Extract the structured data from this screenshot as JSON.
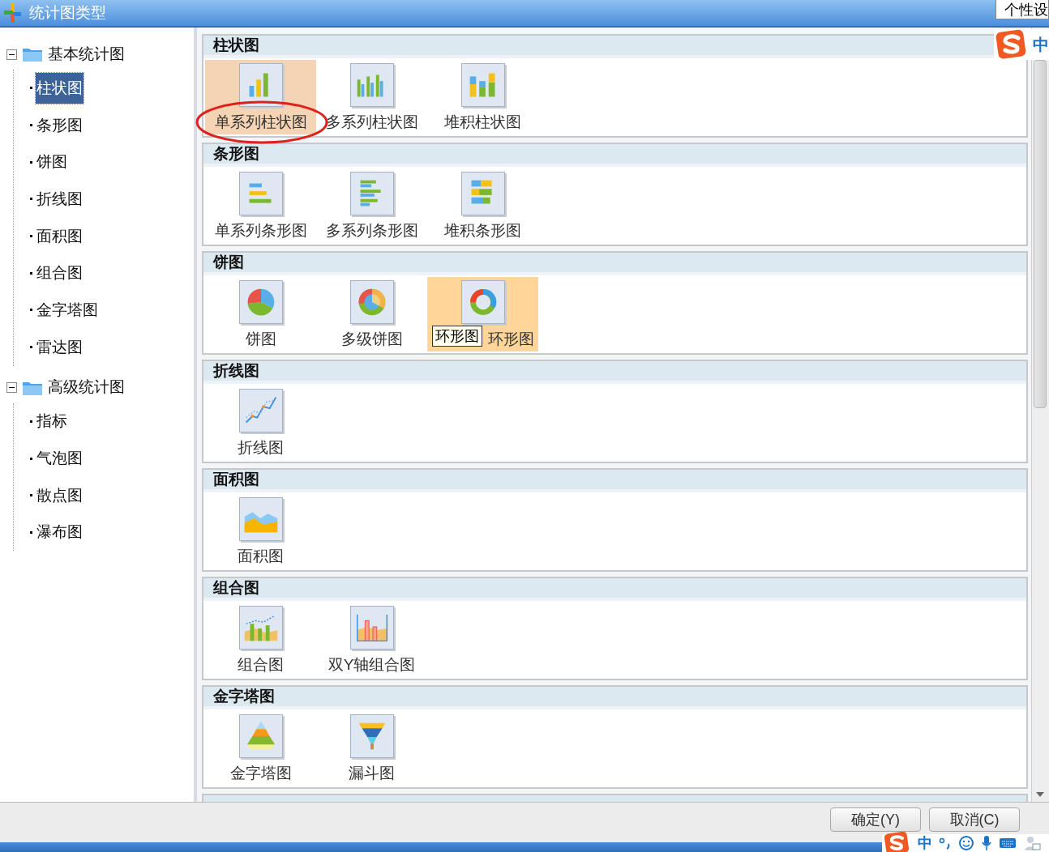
{
  "window": {
    "title": "统计图类型"
  },
  "tree": [
    {
      "label": "基本统计图",
      "expanded": true,
      "children": [
        {
          "label": "柱状图",
          "selected": true
        },
        {
          "label": "条形图",
          "selected": false
        },
        {
          "label": "饼图",
          "selected": false
        },
        {
          "label": "折线图",
          "selected": false
        },
        {
          "label": "面积图",
          "selected": false
        },
        {
          "label": "组合图",
          "selected": false
        },
        {
          "label": "金字塔图",
          "selected": false
        },
        {
          "label": "雷达图",
          "selected": false
        }
      ]
    },
    {
      "label": "高级统计图",
      "expanded": true,
      "children": [
        {
          "label": "指标",
          "selected": false
        },
        {
          "label": "气泡图",
          "selected": false
        },
        {
          "label": "散点图",
          "selected": false
        },
        {
          "label": "瀑布图",
          "selected": false
        }
      ]
    }
  ],
  "sections": [
    {
      "title": "柱状图",
      "items": [
        {
          "label": "单系列柱状图",
          "kind": "bar",
          "selected": true,
          "hovered": false
        },
        {
          "label": "多系列柱状图",
          "kind": "multibar",
          "selected": false,
          "hovered": false
        },
        {
          "label": "堆积柱状图",
          "kind": "stackbar",
          "selected": false,
          "hovered": false
        }
      ]
    },
    {
      "title": "条形图",
      "items": [
        {
          "label": "单系列条形图",
          "kind": "hbar",
          "selected": false,
          "hovered": false
        },
        {
          "label": "多系列条形图",
          "kind": "multihbar",
          "selected": false,
          "hovered": false
        },
        {
          "label": "堆积条形图",
          "kind": "stackhbar",
          "selected": false,
          "hovered": false
        }
      ]
    },
    {
      "title": "饼图",
      "items": [
        {
          "label": "饼图",
          "kind": "pie",
          "selected": false,
          "hovered": false
        },
        {
          "label": "多级饼图",
          "kind": "multipie",
          "selected": false,
          "hovered": false
        },
        {
          "label": "环形图",
          "kind": "donut",
          "selected": false,
          "hovered": true,
          "tooltip": "环形图"
        }
      ]
    },
    {
      "title": "折线图",
      "items": [
        {
          "label": "折线图",
          "kind": "line",
          "selected": false,
          "hovered": false
        }
      ]
    },
    {
      "title": "面积图",
      "items": [
        {
          "label": "面积图",
          "kind": "area",
          "selected": false,
          "hovered": false
        }
      ]
    },
    {
      "title": "组合图",
      "items": [
        {
          "label": "组合图",
          "kind": "combo",
          "selected": false,
          "hovered": false
        },
        {
          "label": "双Y轴组合图",
          "kind": "dualaxis",
          "selected": false,
          "hovered": false
        }
      ]
    },
    {
      "title": "金字塔图",
      "items": [
        {
          "label": "金字塔图",
          "kind": "pyramid",
          "selected": false,
          "hovered": false
        },
        {
          "label": "漏斗图",
          "kind": "funnel",
          "selected": false,
          "hovered": false
        }
      ]
    }
  ],
  "buttons": [
    "确定(Y)",
    "取消(C)"
  ],
  "ime_tooltip": "个性设",
  "ime_indicator": "中",
  "ime_toolbar": {
    "mode": "中"
  }
}
